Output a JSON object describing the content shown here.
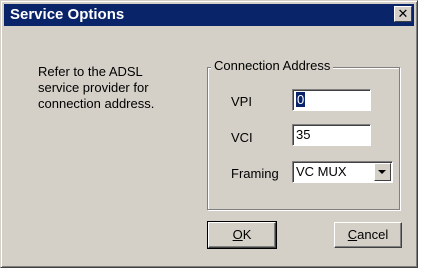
{
  "window": {
    "title": "Service Options",
    "close_label": "✕"
  },
  "info": {
    "lines": [
      "Refer to the ADSL",
      "service provider for",
      "connection address."
    ]
  },
  "group": {
    "legend": "Connection Address",
    "vpi": {
      "label": "VPI",
      "value": "0"
    },
    "vci": {
      "label": "VCI",
      "value": "35"
    },
    "framing": {
      "label": "Framing",
      "value": "VC MUX"
    }
  },
  "buttons": {
    "ok": {
      "mnemonic": "O",
      "rest": "K"
    },
    "cancel": {
      "mnemonic": "C",
      "rest": "ancel"
    }
  },
  "colors": {
    "titlebar": "#0a246a",
    "face": "#d4d0c8",
    "selection": "#0a246a"
  }
}
